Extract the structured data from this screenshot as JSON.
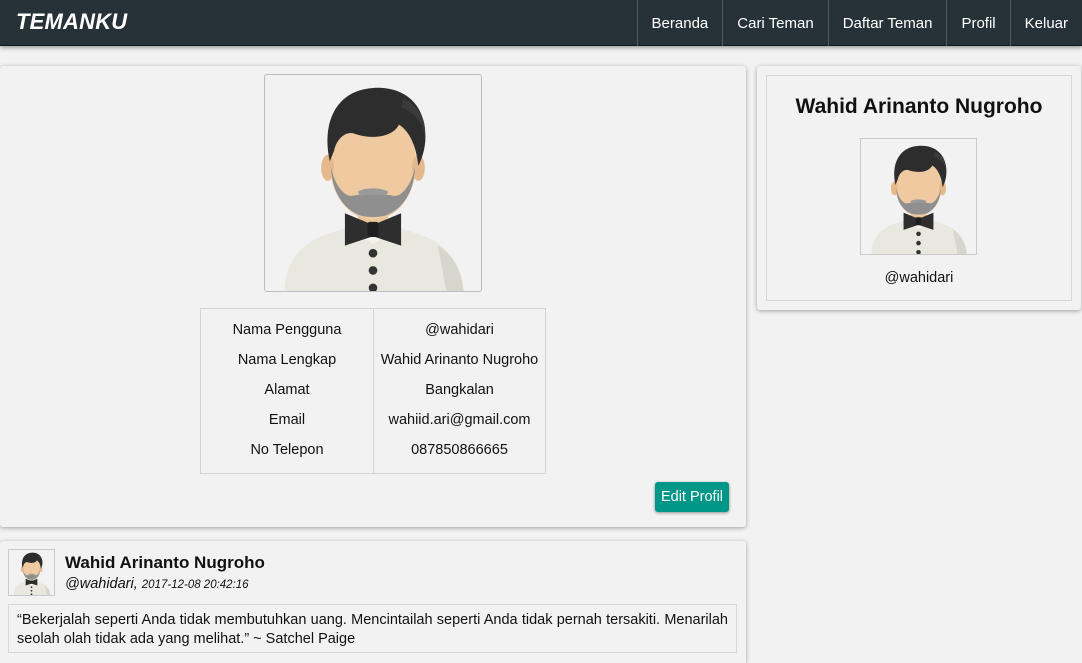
{
  "navbar": {
    "brand": "TEMANKU",
    "links": [
      "Beranda",
      "Cari Teman",
      "Daftar Teman",
      "Profil",
      "Keluar"
    ]
  },
  "profile": {
    "rows": [
      {
        "label": "Nama Pengguna",
        "value": "@wahidari"
      },
      {
        "label": "Nama Lengkap",
        "value": "Wahid Arinanto Nugroho"
      },
      {
        "label": "Alamat",
        "value": "Bangkalan"
      },
      {
        "label": "Email",
        "value": "wahiid.ari@gmail.com"
      },
      {
        "label": "No Telepon",
        "value": "087850866665"
      }
    ],
    "edit_label": "Edit Profil"
  },
  "side": {
    "name": "Wahid Arinanto Nugroho",
    "username": "@wahidari"
  },
  "post": {
    "name": "Wahid Arinanto Nugroho",
    "username": "@wahidari,",
    "timestamp": "2017-12-08 20:42:16",
    "text": "“Bekerjalah seperti Anda tidak membutuhkan uang. Mencintailah seperti Anda tidak pernah tersakiti. Menarilah seolah olah tidak ada yang melihat.” ~ Satchel Paige"
  },
  "icons": {
    "avatar": "man-with-bowtie-avatar"
  },
  "colors": {
    "navbar": "#263238",
    "accent": "#009688",
    "background": "#f2f2f2"
  }
}
